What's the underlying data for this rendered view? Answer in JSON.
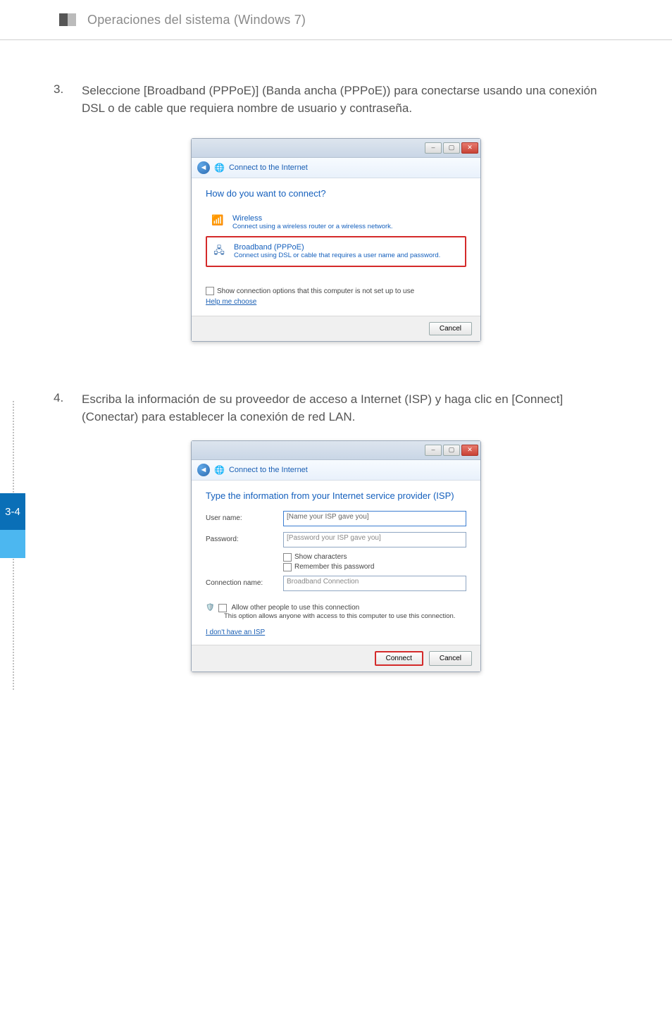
{
  "header": {
    "title": "Operaciones del sistema (Windows 7)"
  },
  "page_tab": "3-4",
  "step3": {
    "num": "3.",
    "text": "Seleccione [Broadband (PPPoE)] (Banda ancha (PPPoE)) para conectarse usando una conexión DSL o de cable que requiera nombre de usuario y contraseña."
  },
  "dialog1": {
    "breadcrumb": "Connect to the Internet",
    "heading": "How do you want to connect?",
    "option_wireless": {
      "title": "Wireless",
      "sub": "Connect using a wireless router or a wireless network."
    },
    "option_broadband": {
      "title": "Broadband (PPPoE)",
      "sub": "Connect using DSL or cable that requires a user name and password."
    },
    "show_options_label": "Show connection options that this computer is not set up to use",
    "help_link": "Help me choose",
    "cancel": "Cancel"
  },
  "step4": {
    "num": "4.",
    "text": "Escriba la información de su proveedor de acceso a Internet (ISP) y haga clic en [Connect] (Conectar) para establecer la conexión de red LAN."
  },
  "dialog2": {
    "breadcrumb": "Connect to the Internet",
    "heading": "Type the information from your Internet service provider (ISP)",
    "labels": {
      "user": "User name:",
      "password": "Password:",
      "conn_name": "Connection name:"
    },
    "placeholders": {
      "user": "[Name your ISP gave you]",
      "password": "[Password your ISP gave you]"
    },
    "conn_name_value": "Broadband Connection",
    "show_chars": "Show characters",
    "remember": "Remember this password",
    "allow_title": "Allow other people to use this connection",
    "allow_desc": "This option allows anyone with access to this computer to use this connection.",
    "no_isp_link": "I don't have an ISP",
    "connect": "Connect",
    "cancel": "Cancel"
  }
}
